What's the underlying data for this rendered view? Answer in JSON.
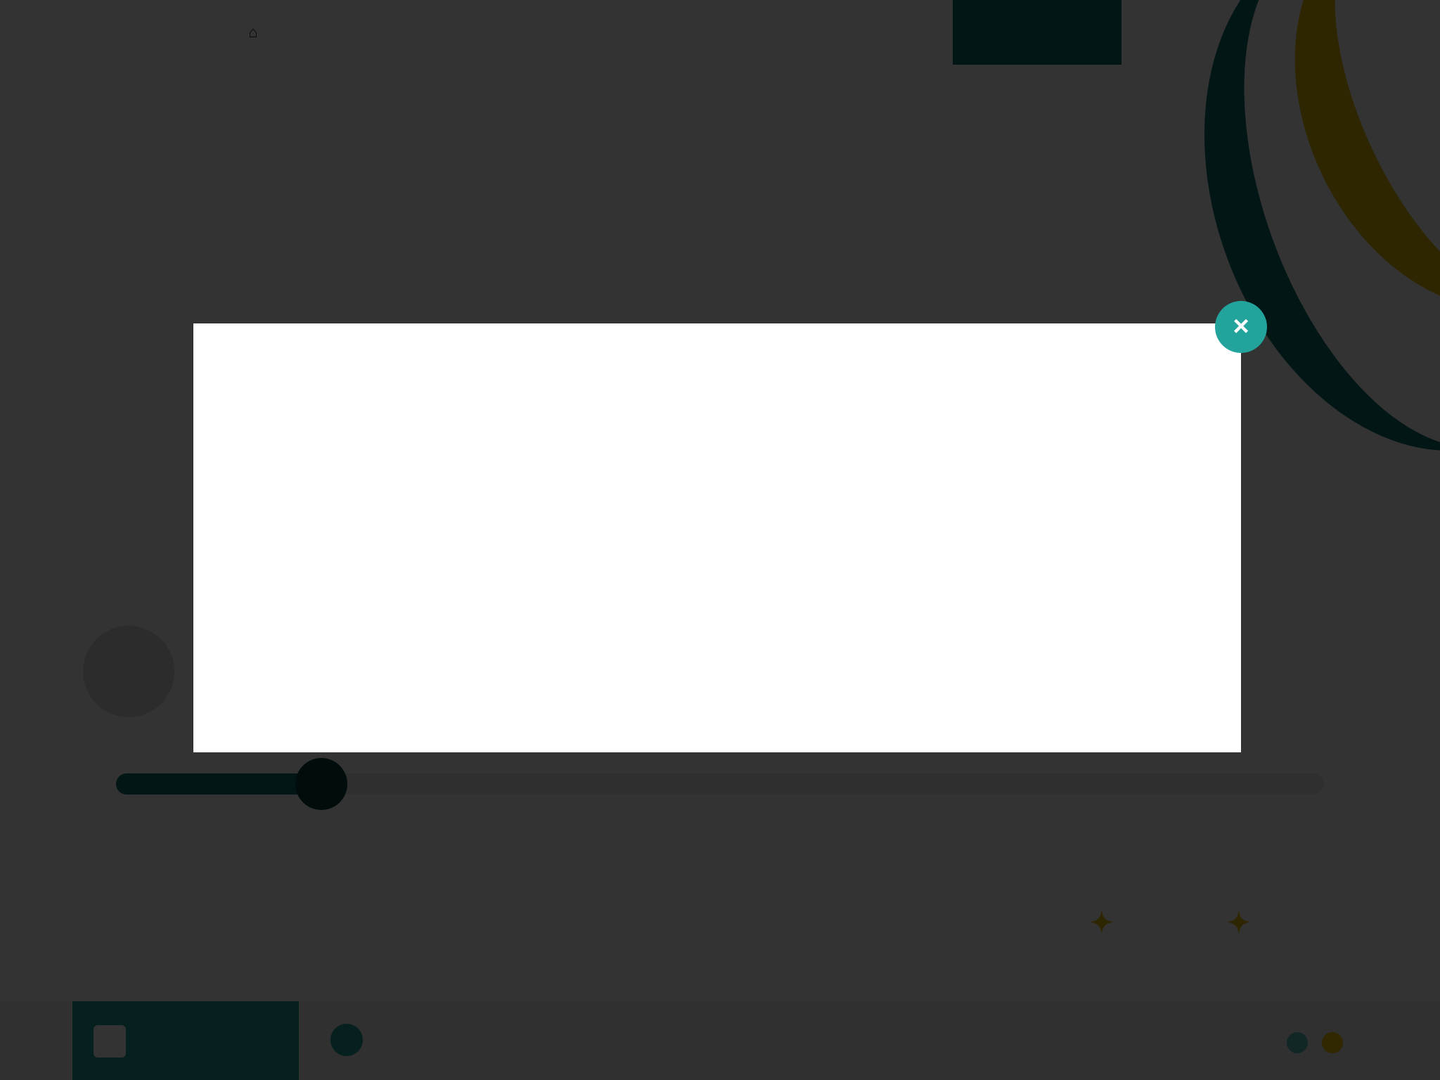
{
  "nav": {
    "home_icon": "home-icon",
    "items": [
      {
        "label": ""
      },
      {
        "label": ""
      },
      {
        "label": ""
      },
      {
        "label": ""
      },
      {
        "label": ""
      },
      {
        "label": ""
      },
      {
        "label": ""
      }
    ],
    "active_index": 4
  },
  "hero": {
    "eyebrow": "",
    "headline": "",
    "subhead": ""
  },
  "slider": {
    "value_fraction": 0.17,
    "labels": [
      "",
      "",
      ""
    ]
  },
  "footer": {
    "footnote": "",
    "logos": [
      "",
      ""
    ]
  },
  "modal": {
    "title": "",
    "references": [
      {
        "number": "",
        "text": ""
      },
      {
        "number": "",
        "text": ""
      },
      {
        "number": "",
        "text": ""
      }
    ],
    "close_label": "×"
  },
  "bottom_tabs": {
    "tab_pi": {
      "label": ""
    },
    "tab_footnotes": {
      "label": ""
    }
  },
  "colors": {
    "brand_teal": "#0b6e6a",
    "accent_teal": "#22a39b",
    "brand_gold": "#e6bd00",
    "overlay": "rgba(0,0,0,0.80)"
  }
}
